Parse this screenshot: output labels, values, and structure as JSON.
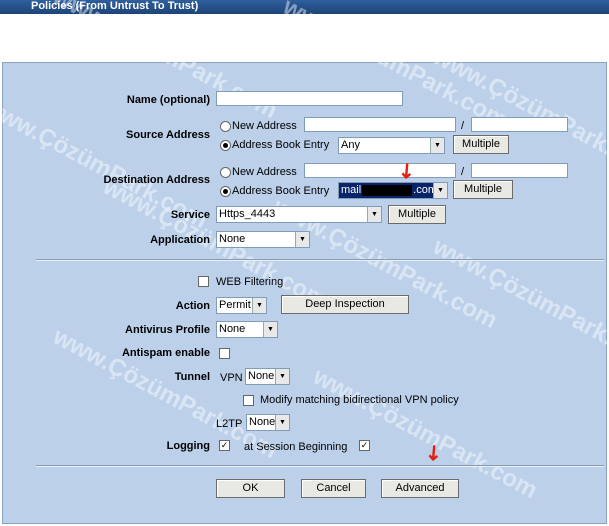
{
  "title": "Policies (From Untrust To Trust)",
  "watermark": "www.ÇözümPark.com",
  "form": {
    "name_label": "Name (optional)",
    "name_value": "",
    "source": {
      "label": "Source Address",
      "new_address": "New Address",
      "address_book": "Address Book Entry",
      "selected_entry": "Any",
      "multiple": "Multiple",
      "slash": "/"
    },
    "destination": {
      "label": "Destination Address",
      "new_address": "New Address",
      "address_book": "Address Book Entry",
      "selected_entry_prefix": "mail",
      "selected_entry_suffix": ".com",
      "multiple": "Multiple",
      "slash": "/"
    },
    "service": {
      "label": "Service",
      "value": "Https_4443",
      "multiple": "Multiple"
    },
    "application": {
      "label": "Application",
      "value": "None"
    },
    "web_filtering": "WEB Filtering",
    "action": {
      "label": "Action",
      "value": "Permit",
      "deep_inspection": "Deep Inspection"
    },
    "antivirus": {
      "label": "Antivirus Profile",
      "value": "None"
    },
    "antispam": {
      "label": "Antispam enable"
    },
    "tunnel": {
      "label": "Tunnel",
      "vpn_label": "VPN",
      "vpn_value": "None",
      "modify_label": "Modify matching bidirectional VPN policy",
      "l2tp_label": "L2TP",
      "l2tp_value": "None"
    },
    "logging": {
      "label": "Logging",
      "session_label": "at Session Beginning"
    }
  },
  "buttons": {
    "ok": "OK",
    "cancel": "Cancel",
    "advanced": "Advanced"
  }
}
